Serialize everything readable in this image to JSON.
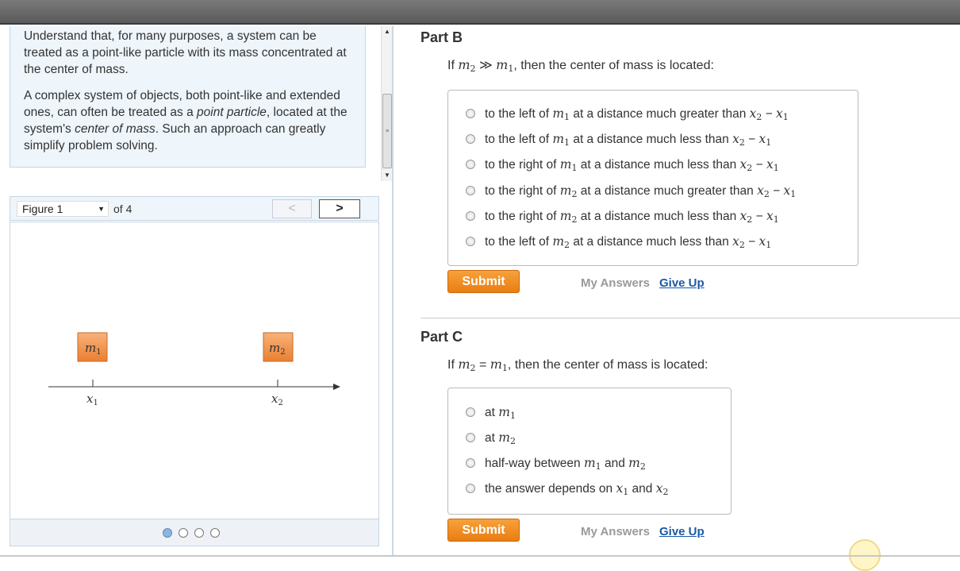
{
  "intro": {
    "p1": "Understand that, for many purposes, a system can be treated as a point-like particle with its mass concentrated at the center of mass.",
    "p2_a": "A complex system of objects, both point-like and extended ones, can often be treated as a ",
    "p2_em1": "point particle",
    "p2_b": ", located at the system's ",
    "p2_em2": "center of mass",
    "p2_c": ". Such an approach can greatly simplify problem solving."
  },
  "figure_nav": {
    "selected": "Figure 1",
    "of_label": "of 4",
    "prev": "<",
    "next": ">",
    "pages": 4,
    "active_page": 1
  },
  "figure": {
    "mass1": "m",
    "mass1_sub": "1",
    "mass2": "m",
    "mass2_sub": "2",
    "x1": "x",
    "x1_sub": "1",
    "x2": "x",
    "x2_sub": "2",
    "box_color": "#f0913f"
  },
  "partB": {
    "title": "Part B",
    "question_prefix": "If ",
    "question_relation": " ≫ ",
    "question_suffix": ", then the center of mass is located:",
    "choices": [
      {
        "pre": "to the left of ",
        "mass": "m",
        "sub": "1",
        "post": " at a distance much greater than "
      },
      {
        "pre": "to the left of ",
        "mass": "m",
        "sub": "1",
        "post": " at a distance much less than "
      },
      {
        "pre": "to the right of ",
        "mass": "m",
        "sub": "1",
        "post": " at a distance much less than "
      },
      {
        "pre": "to the right of ",
        "mass": "m",
        "sub": "2",
        "post": " at a distance much greater than "
      },
      {
        "pre": "to the right of ",
        "mass": "m",
        "sub": "2",
        "post": " at a distance much less than "
      },
      {
        "pre": "to the left of ",
        "mass": "m",
        "sub": "2",
        "post": " at a distance much less than "
      }
    ],
    "submit": "Submit",
    "my_answers": "My Answers",
    "give_up": "Give Up"
  },
  "partC": {
    "title": "Part C",
    "question_prefix": "If ",
    "question_relation": " = ",
    "question_suffix": ", then the center of mass is located:",
    "choice1_pre": "at ",
    "choice2_pre": "at ",
    "choice3_pre": "half-way between ",
    "choice3_mid": " and ",
    "choice4_pre": "the answer depends on ",
    "choice4_mid": " and ",
    "submit": "Submit",
    "my_answers": "My Answers",
    "give_up": "Give Up"
  },
  "math": {
    "m": "m",
    "x": "x",
    "sub1": "1",
    "sub2": "2",
    "minus": " − "
  },
  "colors": {
    "accent": "#f08a1e",
    "link": "#1b5aa8",
    "panel": "#eef5fb"
  }
}
